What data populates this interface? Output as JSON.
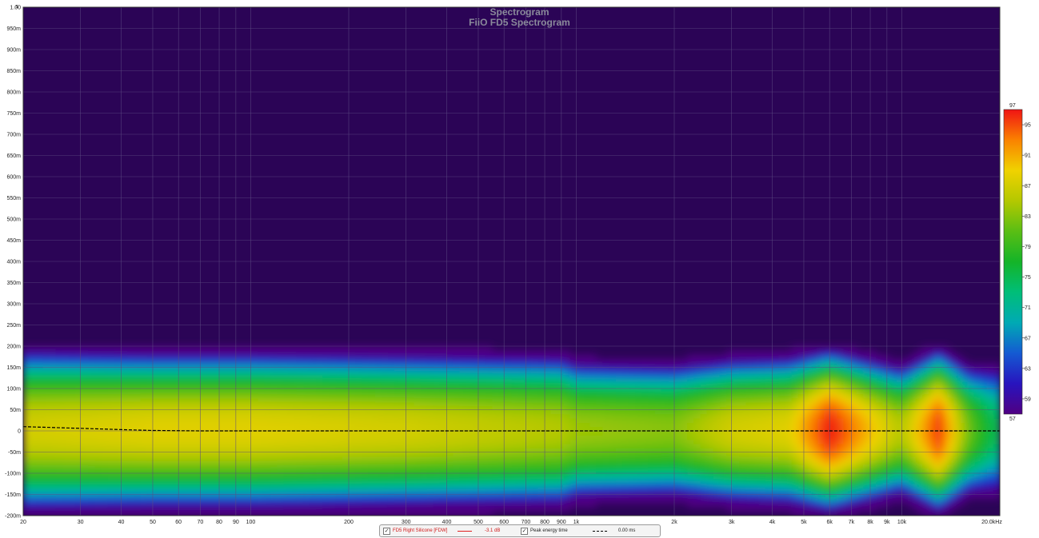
{
  "chart_data": {
    "type": "heatmap",
    "title": "Spectrogram",
    "subtitle": "FiiO FD5 Spectrogram",
    "x_scale": "log",
    "xlim": [
      20,
      20000
    ],
    "x_tick_labels": [
      {
        "v": 20,
        "t": "20"
      },
      {
        "v": 30,
        "t": "30"
      },
      {
        "v": 40,
        "t": "40"
      },
      {
        "v": 50,
        "t": "50"
      },
      {
        "v": 60,
        "t": "60"
      },
      {
        "v": 70,
        "t": "70"
      },
      {
        "v": 80,
        "t": "80"
      },
      {
        "v": 90,
        "t": "90"
      },
      {
        "v": 100,
        "t": "100"
      },
      {
        "v": 200,
        "t": "200"
      },
      {
        "v": 300,
        "t": "300"
      },
      {
        "v": 400,
        "t": "400"
      },
      {
        "v": 500,
        "t": "500"
      },
      {
        "v": 600,
        "t": "600"
      },
      {
        "v": 700,
        "t": "700"
      },
      {
        "v": 800,
        "t": "800"
      },
      {
        "v": 900,
        "t": "900"
      },
      {
        "v": 1000,
        "t": "1k"
      },
      {
        "v": 2000,
        "t": "2k"
      },
      {
        "v": 3000,
        "t": "3k"
      },
      {
        "v": 4000,
        "t": "4k"
      },
      {
        "v": 5000,
        "t": "5k"
      },
      {
        "v": 6000,
        "t": "6k"
      },
      {
        "v": 7000,
        "t": "7k"
      },
      {
        "v": 8000,
        "t": "8k"
      },
      {
        "v": 9000,
        "t": "9k"
      },
      {
        "v": 10000,
        "t": "10k"
      },
      {
        "v": 20000,
        "t": "20.0kHz"
      }
    ],
    "ylim": [
      -200,
      1000
    ],
    "y_tick_labels": [
      {
        "v": 1000,
        "t": "1.00"
      },
      {
        "v": 950,
        "t": "950m"
      },
      {
        "v": 900,
        "t": "900m"
      },
      {
        "v": 850,
        "t": "850m"
      },
      {
        "v": 800,
        "t": "800m"
      },
      {
        "v": 750,
        "t": "750m"
      },
      {
        "v": 700,
        "t": "700m"
      },
      {
        "v": 650,
        "t": "650m"
      },
      {
        "v": 600,
        "t": "600m"
      },
      {
        "v": 550,
        "t": "550m"
      },
      {
        "v": 500,
        "t": "500m"
      },
      {
        "v": 450,
        "t": "450m"
      },
      {
        "v": 400,
        "t": "400m"
      },
      {
        "v": 350,
        "t": "350m"
      },
      {
        "v": 300,
        "t": "300m"
      },
      {
        "v": 250,
        "t": "250m"
      },
      {
        "v": 200,
        "t": "200m"
      },
      {
        "v": 150,
        "t": "150m"
      },
      {
        "v": 100,
        "t": "100m"
      },
      {
        "v": 50,
        "t": "50m"
      },
      {
        "v": 0,
        "t": "0"
      },
      {
        "v": -50,
        "t": "-50m"
      },
      {
        "v": -100,
        "t": "-100m"
      },
      {
        "v": -150,
        "t": "-150m"
      },
      {
        "v": -200,
        "t": "-200m"
      }
    ],
    "y_label_prefix": "s",
    "grid": true,
    "colorbar": {
      "min": 57,
      "max": 97,
      "tick_labels": [
        "97",
        "95",
        "91",
        "87",
        "83",
        "79",
        "75",
        "71",
        "67",
        "63",
        "59",
        "57"
      ],
      "tick_values": [
        97,
        95,
        91,
        87,
        83,
        79,
        75,
        71,
        67,
        63,
        59,
        57
      ]
    },
    "level_profile": [
      {
        "f": 20,
        "level": 87,
        "extent": 190
      },
      {
        "f": 50,
        "level": 88,
        "extent": 185
      },
      {
        "f": 100,
        "level": 88,
        "extent": 185
      },
      {
        "f": 300,
        "level": 87,
        "extent": 180
      },
      {
        "f": 900,
        "level": 85,
        "extent": 175
      },
      {
        "f": 1000,
        "level": 84,
        "extent": 160
      },
      {
        "f": 2000,
        "level": 83,
        "extent": 155
      },
      {
        "f": 3000,
        "level": 87,
        "extent": 170
      },
      {
        "f": 4500,
        "level": 88,
        "extent": 175
      },
      {
        "f": 6000,
        "level": 97,
        "extent": 195
      },
      {
        "f": 8000,
        "level": 90,
        "extent": 170
      },
      {
        "f": 10000,
        "level": 85,
        "extent": 150
      },
      {
        "f": 13000,
        "level": 96,
        "extent": 195
      },
      {
        "f": 16000,
        "level": 82,
        "extent": 150
      },
      {
        "f": 19000,
        "level": 75,
        "extent": 145
      }
    ],
    "series": [
      {
        "name": "Peak energy time",
        "x": [
          20,
          30,
          40,
          50,
          70,
          100,
          1000,
          20000
        ],
        "y": [
          10,
          6,
          3,
          1,
          0,
          0,
          0,
          0
        ]
      }
    ],
    "colors": {
      "background": "#2b0456",
      "grid": "#5c4a82",
      "curve": "#000000"
    }
  },
  "legend": {
    "items": [
      {
        "label": "FD5 Right Silicone [FDW]",
        "value": "-3.1 dB",
        "color": "#e02020",
        "style": "solid",
        "checked": "✓"
      },
      {
        "label": "Peak energy time",
        "value": "0.00 ms",
        "color": "#000000",
        "style": "dashed",
        "checked": "✓"
      }
    ]
  }
}
